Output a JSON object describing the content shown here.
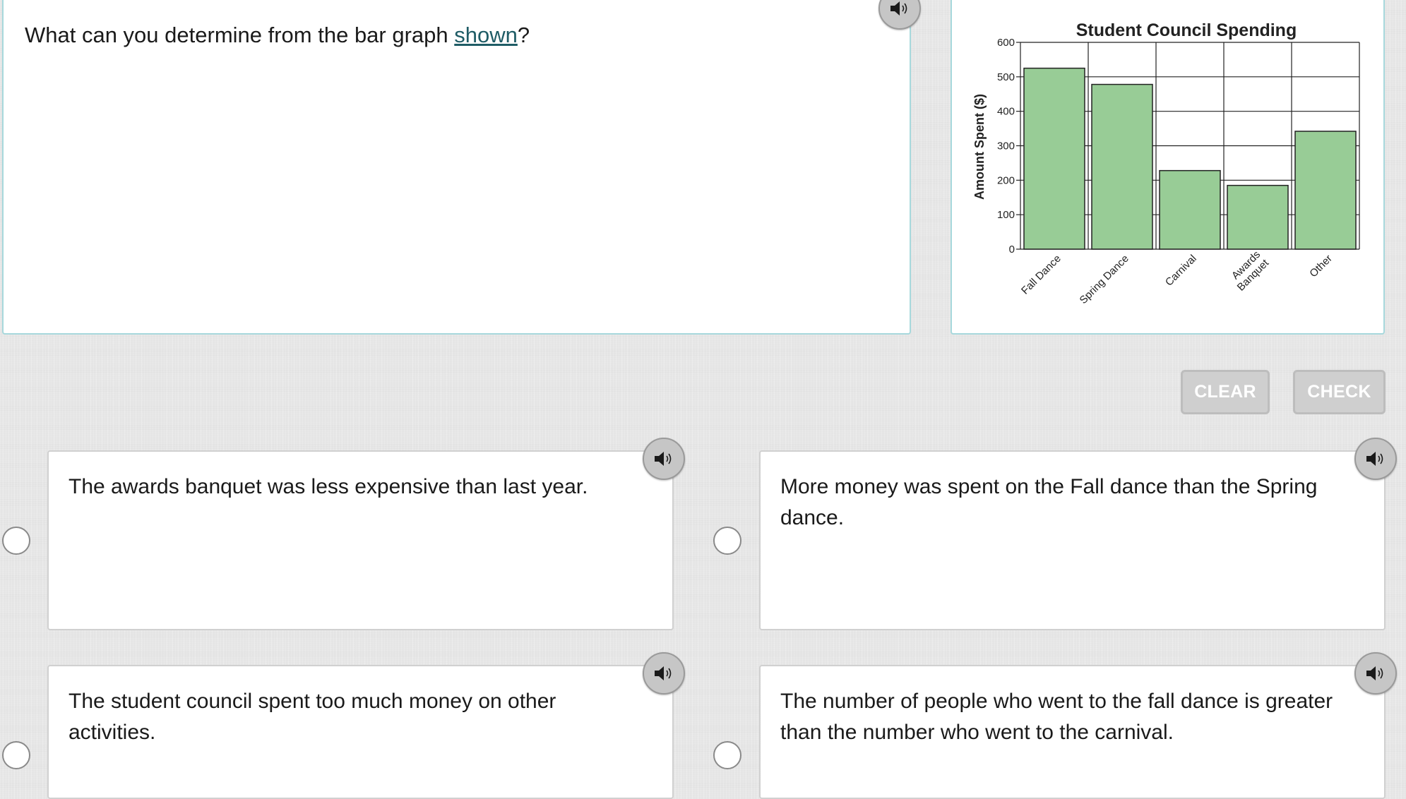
{
  "question": {
    "text_before": "What can you determine from the bar graph ",
    "link_text": "shown",
    "text_after": "?"
  },
  "buttons": {
    "clear_label": "CLEAR",
    "check_label": "CHECK"
  },
  "choices": [
    {
      "text": "The awards banquet was less expensive than last year."
    },
    {
      "text": "More money was spent on the Fall dance than the Spring dance."
    },
    {
      "text": "The student council spent too much money on other activities."
    },
    {
      "text": "The number of people who went to the fall dance is greater than the number who went to the carnival."
    }
  ],
  "icons": {
    "audio": "speaker-icon",
    "radio": "radio-circle"
  },
  "colors": {
    "panel_border": "#a7d8dc",
    "link": "#1f5c66",
    "bar_fill": "#98cc96",
    "button_disabled": "#cfcfcf"
  },
  "chart_data": {
    "type": "bar",
    "title": "Student Council Spending",
    "xlabel": "",
    "ylabel": "Amount Spent ($)",
    "categories": [
      "Fall Dance",
      "Spring Dance",
      "Carnival",
      "Awards Banquet",
      "Other"
    ],
    "category_lines": [
      [
        "Fall Dance"
      ],
      [
        "Spring Dance"
      ],
      [
        "Carnival"
      ],
      [
        "Awards",
        "Banquet"
      ],
      [
        "Other"
      ]
    ],
    "values": [
      525,
      478,
      228,
      185,
      342
    ],
    "ylim": [
      0,
      600
    ],
    "yticks": [
      0,
      100,
      200,
      300,
      400,
      500,
      600
    ],
    "grid": true,
    "legend": "none"
  }
}
